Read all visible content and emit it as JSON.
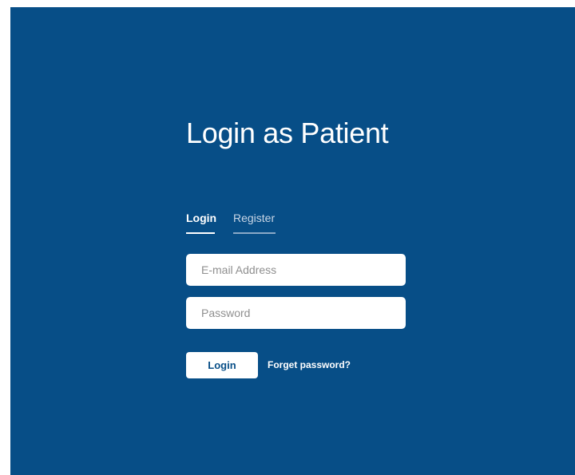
{
  "page": {
    "title": "Login as Patient",
    "background_color": "#074e87"
  },
  "tabs": [
    {
      "label": "Login",
      "active": true
    },
    {
      "label": "Register",
      "active": false
    }
  ],
  "form": {
    "email": {
      "placeholder": "E-mail Address",
      "value": ""
    },
    "password": {
      "placeholder": "Password",
      "value": ""
    },
    "submit_label": "Login",
    "forgot_label": "Forget password?"
  }
}
